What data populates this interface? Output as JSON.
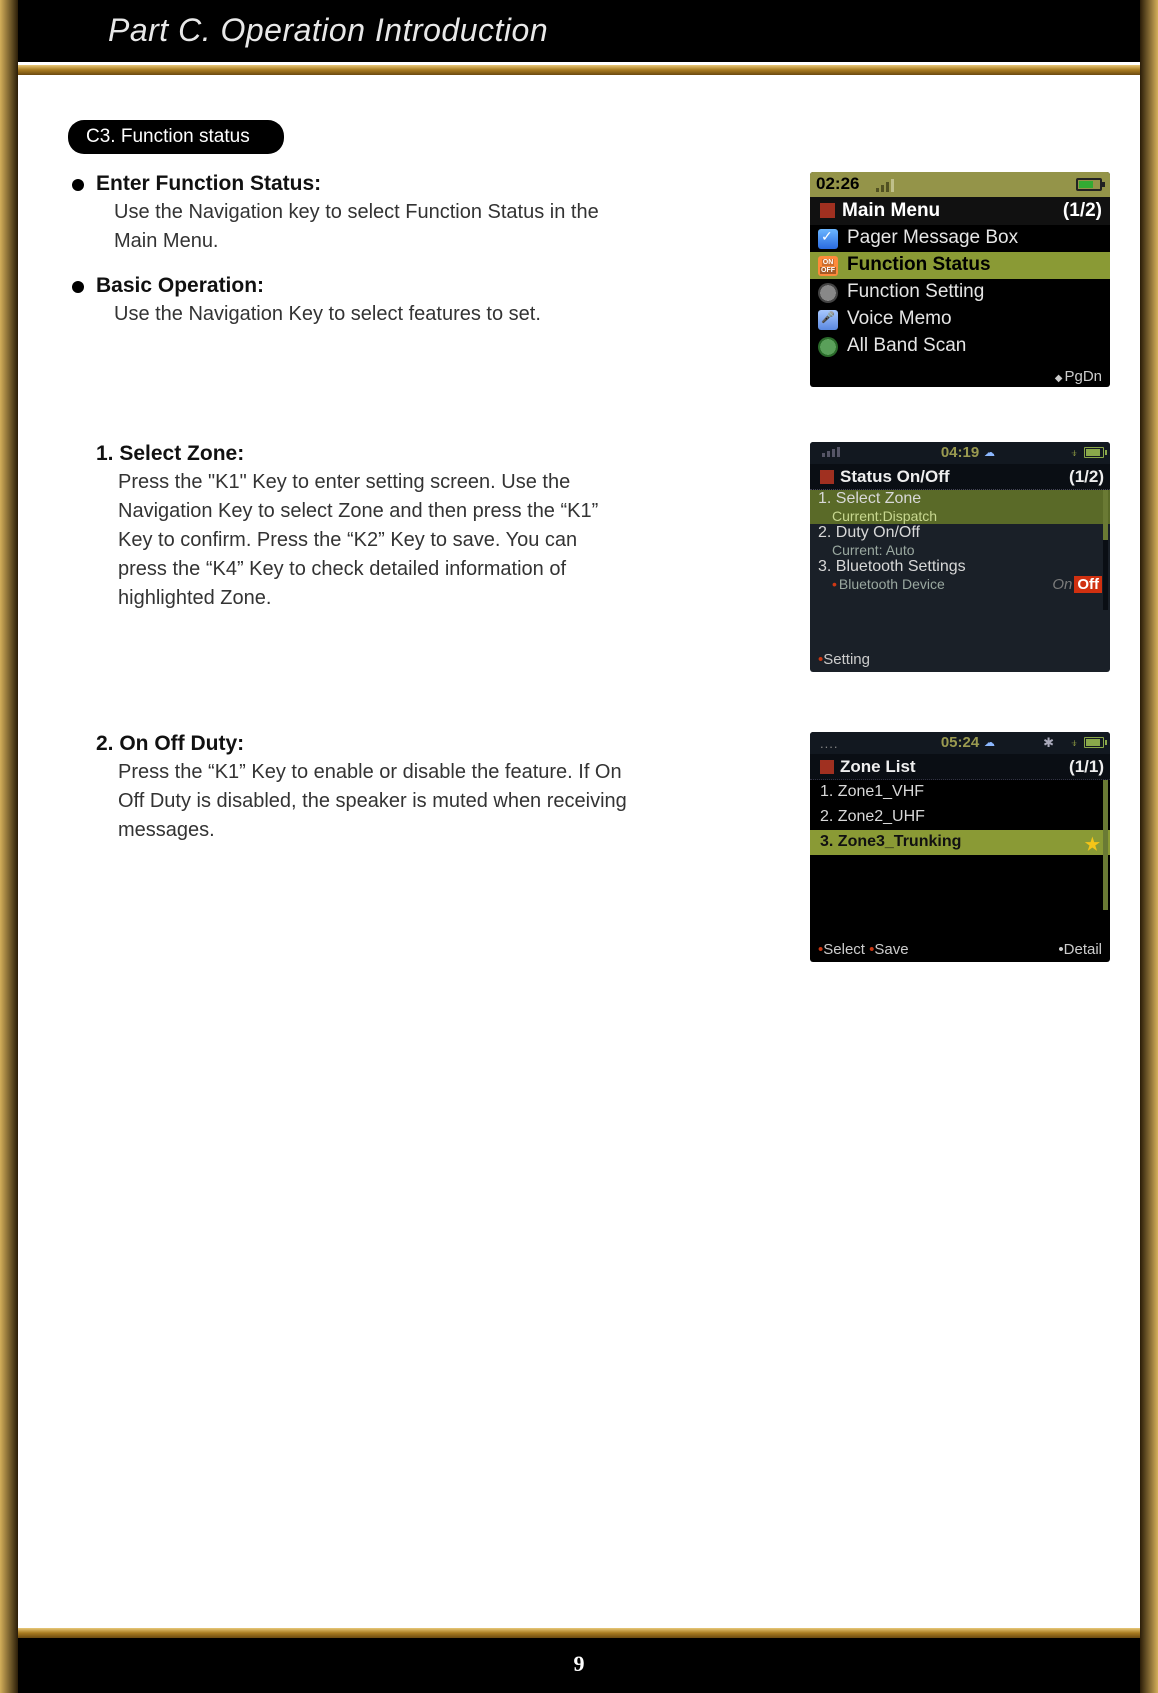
{
  "header": {
    "title": "Part C. Operation Introduction"
  },
  "footer": {
    "page": "9"
  },
  "section": {
    "tag": "C3. Function status"
  },
  "bullets": [
    {
      "head": "Enter Function Status:",
      "body": "Use the Navigation key to select Function Status in the Main Menu."
    },
    {
      "head": "Basic Operation:",
      "body": "Use the Navigation Key to select features to set."
    }
  ],
  "numbered": [
    {
      "head": "1. Select Zone:",
      "body": "Press the \"K1\" Key to enter setting screen. Use the Navigation Key to select Zone and then press the “K1” Key to confirm. Press the “K2” Key to save. You can press the “K4” Key to check detailed information of highlighted Zone."
    },
    {
      "head": "2. On Off Duty:",
      "body": "Press the “K1” Key to enable or disable the feature. If On Off Duty is disabled, the speaker is muted when receiving messages."
    }
  ],
  "screen1": {
    "time": "02:26",
    "title": "Main Menu",
    "page": "(1/2)",
    "items": [
      {
        "label": "Pager Message Box",
        "icon": "pager",
        "selected": false
      },
      {
        "label": "Function Status",
        "icon": "func",
        "selected": true
      },
      {
        "label": "Function Setting",
        "icon": "gear",
        "selected": false
      },
      {
        "label": "Voice Memo",
        "icon": "mic",
        "selected": false
      },
      {
        "label": "All Band Scan",
        "icon": "band",
        "selected": false
      }
    ],
    "footer": "PgDn"
  },
  "screen2": {
    "time": "04:19",
    "title": "Status On/Off",
    "page": "(1/2)",
    "rows": [
      {
        "main": "1. Select Zone",
        "sub": "Current:Dispatch",
        "selected": true
      },
      {
        "main": "2. Duty On/Off",
        "sub": "Current: Auto",
        "selected": false
      },
      {
        "main": "3. Bluetooth Settings",
        "sub_label": "Bluetooth Device",
        "toggle_on": "On",
        "toggle_off": "Off",
        "selected": false
      }
    ],
    "footer": "Setting"
  },
  "screen3": {
    "time": "05:24",
    "title": "Zone List",
    "page": "(1/1)",
    "items": [
      {
        "label": "1.   Zone1_VHF",
        "selected": false
      },
      {
        "label": "2.   Zone2_UHF",
        "selected": false
      },
      {
        "label": "3.   Zone3_Trunking",
        "selected": true,
        "star": true
      }
    ],
    "footer_select": "Select",
    "footer_save": "Save",
    "footer_detail": "Detail"
  }
}
